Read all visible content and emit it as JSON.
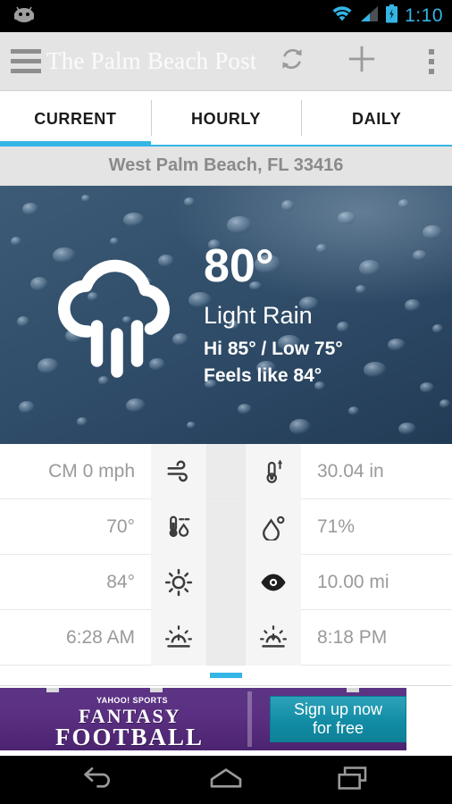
{
  "status_bar": {
    "app_icon": "android-robot-icon",
    "wifi_icon": "wifi-icon",
    "signal_icon": "cell-signal-icon",
    "battery_icon": "battery-charging-icon",
    "time": "1:10",
    "accent_color": "#33b5e5"
  },
  "action_bar": {
    "menu_icon": "hamburger-menu-icon",
    "brand": "The Palm Beach Post",
    "refresh_label": "refresh-icon",
    "add_label": "plus-icon",
    "overflow_label": "overflow-menu-icon",
    "background_color": "#e4e4e4"
  },
  "tabs": {
    "active_index": 0,
    "accent_color": "#33b5e5",
    "items": [
      {
        "label": "CURRENT"
      },
      {
        "label": "HOURLY"
      },
      {
        "label": "DAILY"
      }
    ]
  },
  "location": {
    "text": "West Palm Beach, FL 33416"
  },
  "current": {
    "icon": "cloud-rain-icon",
    "temperature": "80°",
    "condition": "Light Rain",
    "high_low": "Hi 85° / Low 75°",
    "feels_like": "Feels like 84°"
  },
  "details": {
    "rows": [
      {
        "left_value": "CM 0 mph",
        "left_icon": "wind-icon",
        "right_icon": "barometer-thermometer-icon",
        "right_value": "30.04 in"
      },
      {
        "left_value": "70°",
        "left_icon": "dewpoint-thermometer-icon",
        "right_icon": "humidity-droplet-icon",
        "right_value": "71%"
      },
      {
        "left_value": "84°",
        "left_icon": "sun-icon",
        "right_icon": "visibility-eye-icon",
        "right_value": "10.00 mi"
      },
      {
        "left_value": "6:28 AM",
        "left_icon": "sunrise-icon",
        "right_icon": "sunset-icon",
        "right_value": "8:18 PM"
      }
    ]
  },
  "scroll_indicator": {
    "color": "#33b5e5"
  },
  "ad": {
    "sponsor": "YAHOO! SPORTS",
    "headline_line1": "FANTASY",
    "headline_line2": "FOOTBALL",
    "button_line1": "Sign up now",
    "button_line2": "for free",
    "background_color": "#5b2f81",
    "button_color": "#128ca5"
  },
  "nav_bar": {
    "back_label": "back-icon",
    "home_label": "home-icon",
    "recents_label": "recent-apps-icon"
  }
}
